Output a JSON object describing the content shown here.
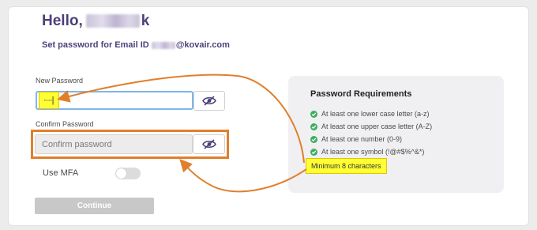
{
  "header": {
    "greeting": "Hello,",
    "greeting_suffix": "k",
    "subtitle_prefix": "Set password for Email ID",
    "subtitle_suffix": "@kovair.com"
  },
  "form": {
    "new_password_label": "New Password",
    "new_password_value": "····|",
    "confirm_password_label": "Confirm Password",
    "confirm_password_placeholder": "Confirm password",
    "mfa_label": "Use MFA",
    "mfa_enabled": false,
    "continue_label": "Continue"
  },
  "requirements": {
    "title": "Password Requirements",
    "items": [
      "At least one lower case letter (a-z)",
      "At least one upper case letter (A-Z)",
      "At least one number (0-9)",
      "At least one symbol (!@#$%^&*)"
    ],
    "highlighted_item": "Minimum 8 characters"
  },
  "colors": {
    "heading": "#4d3f7a",
    "annotation_arrow": "#e07f2c",
    "highlight": "#ffff33",
    "check": "#3cae5e"
  },
  "icons": {
    "password_toggle": "eye-slash-icon",
    "requirement_met": "check-circle-icon"
  }
}
